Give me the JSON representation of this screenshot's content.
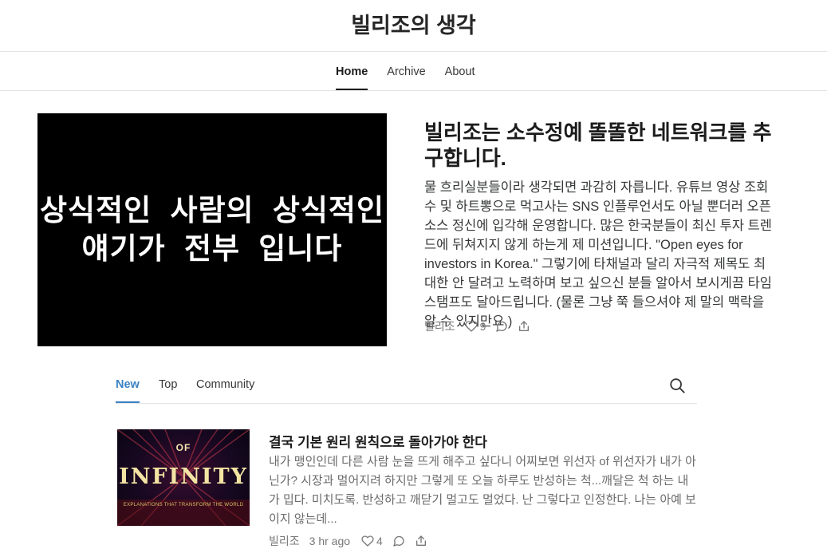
{
  "site": {
    "title": "빌리조의 생각"
  },
  "nav": {
    "tabs": [
      {
        "label": "Home"
      },
      {
        "label": "Archive"
      },
      {
        "label": "About"
      }
    ]
  },
  "hero": {
    "image_text": [
      "상식적인 사람의 상식적인",
      "얘기가 전부 입니다"
    ],
    "title": "빌리조는 소수정예 똘똘한 네트워크를 추구합니다.",
    "excerpt": "물 흐리실분들이라 생각되면 과감히 자릅니다. 유튜브 영상 조회수 및 하트뽕으로 먹고사는 SNS 인플루언서도 아닐 뿐더러 오픈소스 정신에 입각해 운영합니다. 많은 한국분들이 최신 투자 트렌드에 뒤쳐지지 않게 하는게 제 미션입니다. \"Open eyes for investors in Korea.\" 그렇기에 타채널과 달리 자극적 제목도 최대한 안 달려고 노력하며 보고 싶으신 분들 알아서 보시게끔 타임스탬프도 달아드립니다. (물론 그냥 쭉 들으셔야 제 말의 맥락을 알 수 있지만요.)",
    "author": "빌리조",
    "likes": "9"
  },
  "filters": {
    "tabs": [
      {
        "label": "New"
      },
      {
        "label": "Top"
      },
      {
        "label": "Community"
      }
    ]
  },
  "post": {
    "thumb": {
      "top": "OF",
      "main": "INFINITY",
      "sub": "EXPLANATIONS THAT TRANSFORM THE WORLD"
    },
    "title": "결국 기본 원리 원칙으로 돌아가야 한다",
    "excerpt": "내가 맹인인데 다른 사람 눈을 뜨게 해주고 싶다니 어찌보면 위선자 of 위선자가 내가 아닌가? 시장과 멀어지려 하지만 그렇게 또 오늘 하루도 반성하는 척...깨달은 척 하는 내가 밉다. 미치도록. 반성하고 깨닫기 멀고도 멀었다. 난 그렇다고 인정한다. 나는 아예 보이지 않는데...",
    "author": "빌리조",
    "time": "3 hr ago",
    "likes": "4"
  },
  "icons": {
    "like": "heart-icon",
    "comment": "comment-icon",
    "share": "share-icon",
    "search": "search-icon"
  },
  "colors": {
    "accent": "#3b82c4",
    "text": "#363737",
    "muted": "#777777"
  }
}
